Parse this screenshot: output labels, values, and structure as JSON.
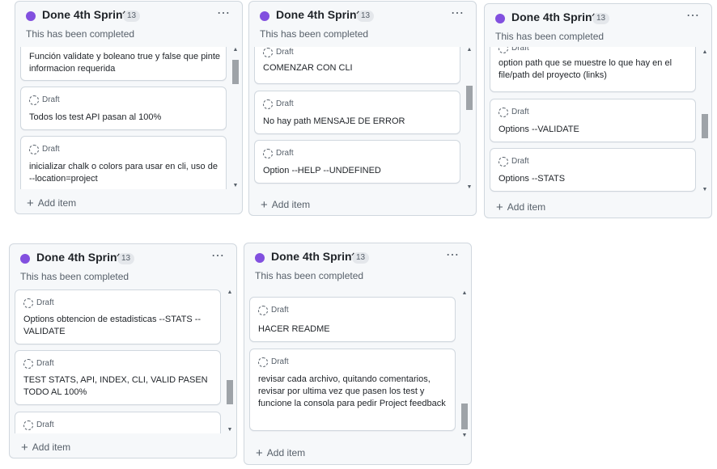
{
  "board": {
    "draft_label": "Draft",
    "add_item_label": "Add item",
    "columns": [
      {
        "title": "Done 4th Sprint",
        "count": "13",
        "description": "This has been completed",
        "cards": [
          {
            "draft": false,
            "text": "Función validate y boleano true y false que pinte informacion requerida"
          },
          {
            "draft": true,
            "text": "Todos los test API pasan al 100%"
          },
          {
            "draft": true,
            "text": "inicializar chalk o colors para usar en cli, uso de --location=project"
          }
        ]
      },
      {
        "title": "Done 4th Sprint",
        "count": "13",
        "description": "This has been completed",
        "cards": [
          {
            "draft": true,
            "text": "COMENZAR CON CLI"
          },
          {
            "draft": true,
            "text": "No hay path MENSAJE DE ERROR"
          },
          {
            "draft": true,
            "text": "Option --HELP --UNDEFINED"
          }
        ]
      },
      {
        "title": "Done 4th Sprint",
        "count": "13",
        "description": "This has been completed",
        "cards": [
          {
            "draft": true,
            "text": "option path que se muestre lo que hay en el file/path del proyecto (links)"
          },
          {
            "draft": true,
            "text": "Options --VALIDATE"
          },
          {
            "draft": true,
            "text": "Options --STATS"
          }
        ]
      },
      {
        "title": "Done 4th Sprint",
        "count": "13",
        "description": "This has been completed",
        "cards": [
          {
            "draft": true,
            "text": "Options obtencion de estadisticas --STATS --VALIDATE"
          },
          {
            "draft": true,
            "text": "TEST STATS, API, INDEX, CLI, VALID PASEN TODO AL 100%"
          },
          {
            "draft": true,
            "text": ""
          }
        ]
      },
      {
        "title": "Done 4th Sprint",
        "count": "13",
        "description": "This has been completed",
        "cards": [
          {
            "draft": true,
            "text": "HACER README"
          },
          {
            "draft": true,
            "text": "revisar cada archivo, quitando comentarios, revisar por ultima vez que pasen los test y funcione la consola para pedir Project feedback"
          }
        ]
      }
    ]
  },
  "icons": {
    "status": "purple-circle-icon",
    "more": "kebab-more-icon",
    "draft": "dashed-circle-draft-icon",
    "add": "plus-icon",
    "scroll_up": "caret-up-icon",
    "scroll_down": "caret-down-icon"
  },
  "colors": {
    "status_dot": "#8250df",
    "column_bg": "#f6f8fa",
    "border": "#d0d7de",
    "muted_text": "#57606a"
  }
}
